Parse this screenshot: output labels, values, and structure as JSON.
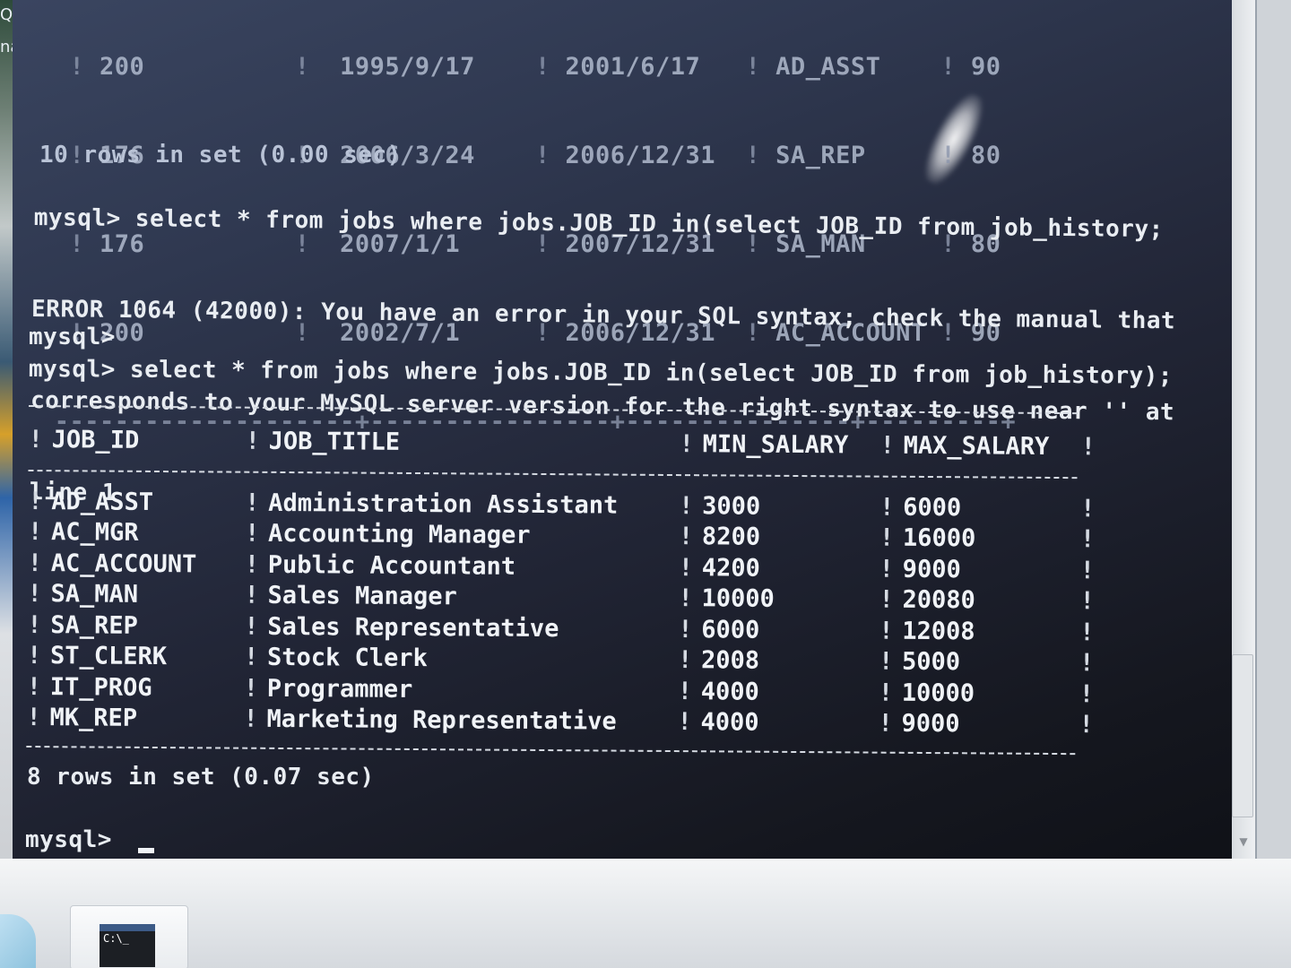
{
  "desktop": {
    "left_text_top": "QL",
    "left_text_mid": "nai"
  },
  "console": {
    "previous_result": {
      "rows": [
        [
          "200",
          "1995/9/17",
          "2001/6/17",
          "AD_ASST",
          "90"
        ],
        [
          "176",
          "2006/3/24",
          "2006/12/31",
          "SA_REP",
          "80"
        ],
        [
          "176",
          "2007/1/1",
          "2007/12/31",
          "SA_MAN",
          "80"
        ],
        [
          "200",
          "2002/7/1",
          "2006/12/31",
          "AC_ACCOUNT",
          "90"
        ]
      ],
      "status": "10 rows in set (0.00 sec)"
    },
    "command1": "mysql> select * from jobs where jobs.JOB_ID in(select JOB_ID from job_history;",
    "error_lines": [
      "ERROR 1064 (42000): You have an error in your SQL syntax; check the manual that",
      "corresponds to your MySQL server version for the right syntax to use near '' at",
      "line 1"
    ],
    "prompt2": "mysql>",
    "command2": "mysql> select * from jobs where jobs.JOB_ID in(select JOB_ID from job_history);",
    "result": {
      "columns": [
        "JOB_ID",
        "JOB_TITLE",
        "MIN_SALARY",
        "MAX_SALARY"
      ],
      "rows": [
        [
          "AD_ASST",
          "Administration Assistant",
          "3000",
          "6000"
        ],
        [
          "AC_MGR",
          "Accounting Manager",
          "8200",
          "16000"
        ],
        [
          "AC_ACCOUNT",
          "Public Accountant",
          "4200",
          "9000"
        ],
        [
          "SA_MAN",
          "Sales Manager",
          "10000",
          "20080"
        ],
        [
          "SA_REP",
          "Sales Representative",
          "6000",
          "12008"
        ],
        [
          "ST_CLERK",
          "Stock Clerk",
          "2008",
          "5000"
        ],
        [
          "IT_PROG",
          "Programmer",
          "4000",
          "10000"
        ],
        [
          "MK_REP",
          "Marketing Representative",
          "4000",
          "9000"
        ]
      ],
      "status": "8 rows in set (0.07 sec)"
    },
    "final_prompt": "mysql>"
  },
  "taskbar": {
    "task_icon_text": "C:\\_"
  }
}
